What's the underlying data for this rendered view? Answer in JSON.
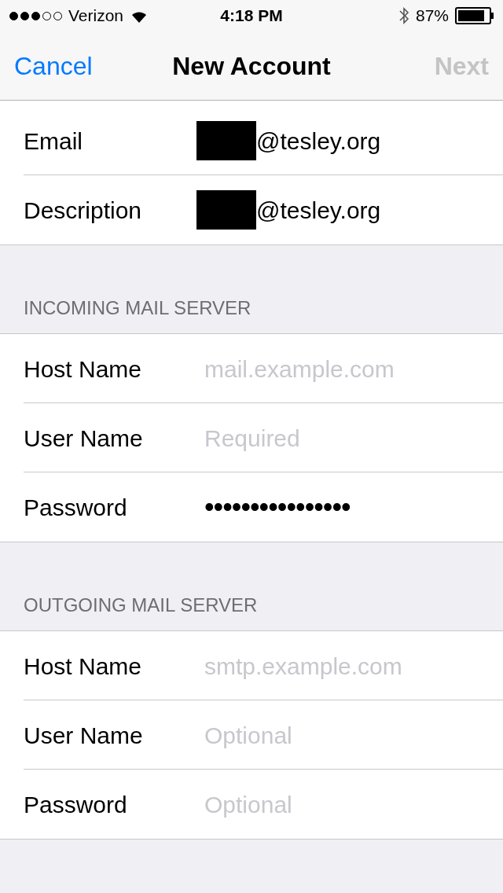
{
  "status_bar": {
    "carrier": "Verizon",
    "time": "4:18 PM",
    "battery": "87%"
  },
  "nav": {
    "cancel": "Cancel",
    "title": "New Account",
    "next": "Next",
    "next_disabled": true
  },
  "sections": [
    {
      "rows": [
        {
          "label": "Email",
          "value": "@tesley.org",
          "redacted": true
        },
        {
          "label": "Description",
          "value": "@tesley.org",
          "redacted": true
        }
      ]
    },
    {
      "header": "INCOMING MAIL SERVER",
      "rows": [
        {
          "label": "Host Name",
          "placeholder": "mail.example.com"
        },
        {
          "label": "User Name",
          "placeholder": "Required"
        },
        {
          "label": "Password",
          "value": "••••••••••••••••",
          "secure": true
        }
      ]
    },
    {
      "header": "OUTGOING MAIL SERVER",
      "rows": [
        {
          "label": "Host Name",
          "placeholder": "smtp.example.com"
        },
        {
          "label": "User Name",
          "placeholder": "Optional"
        },
        {
          "label": "Password",
          "placeholder": "Optional"
        }
      ]
    }
  ]
}
